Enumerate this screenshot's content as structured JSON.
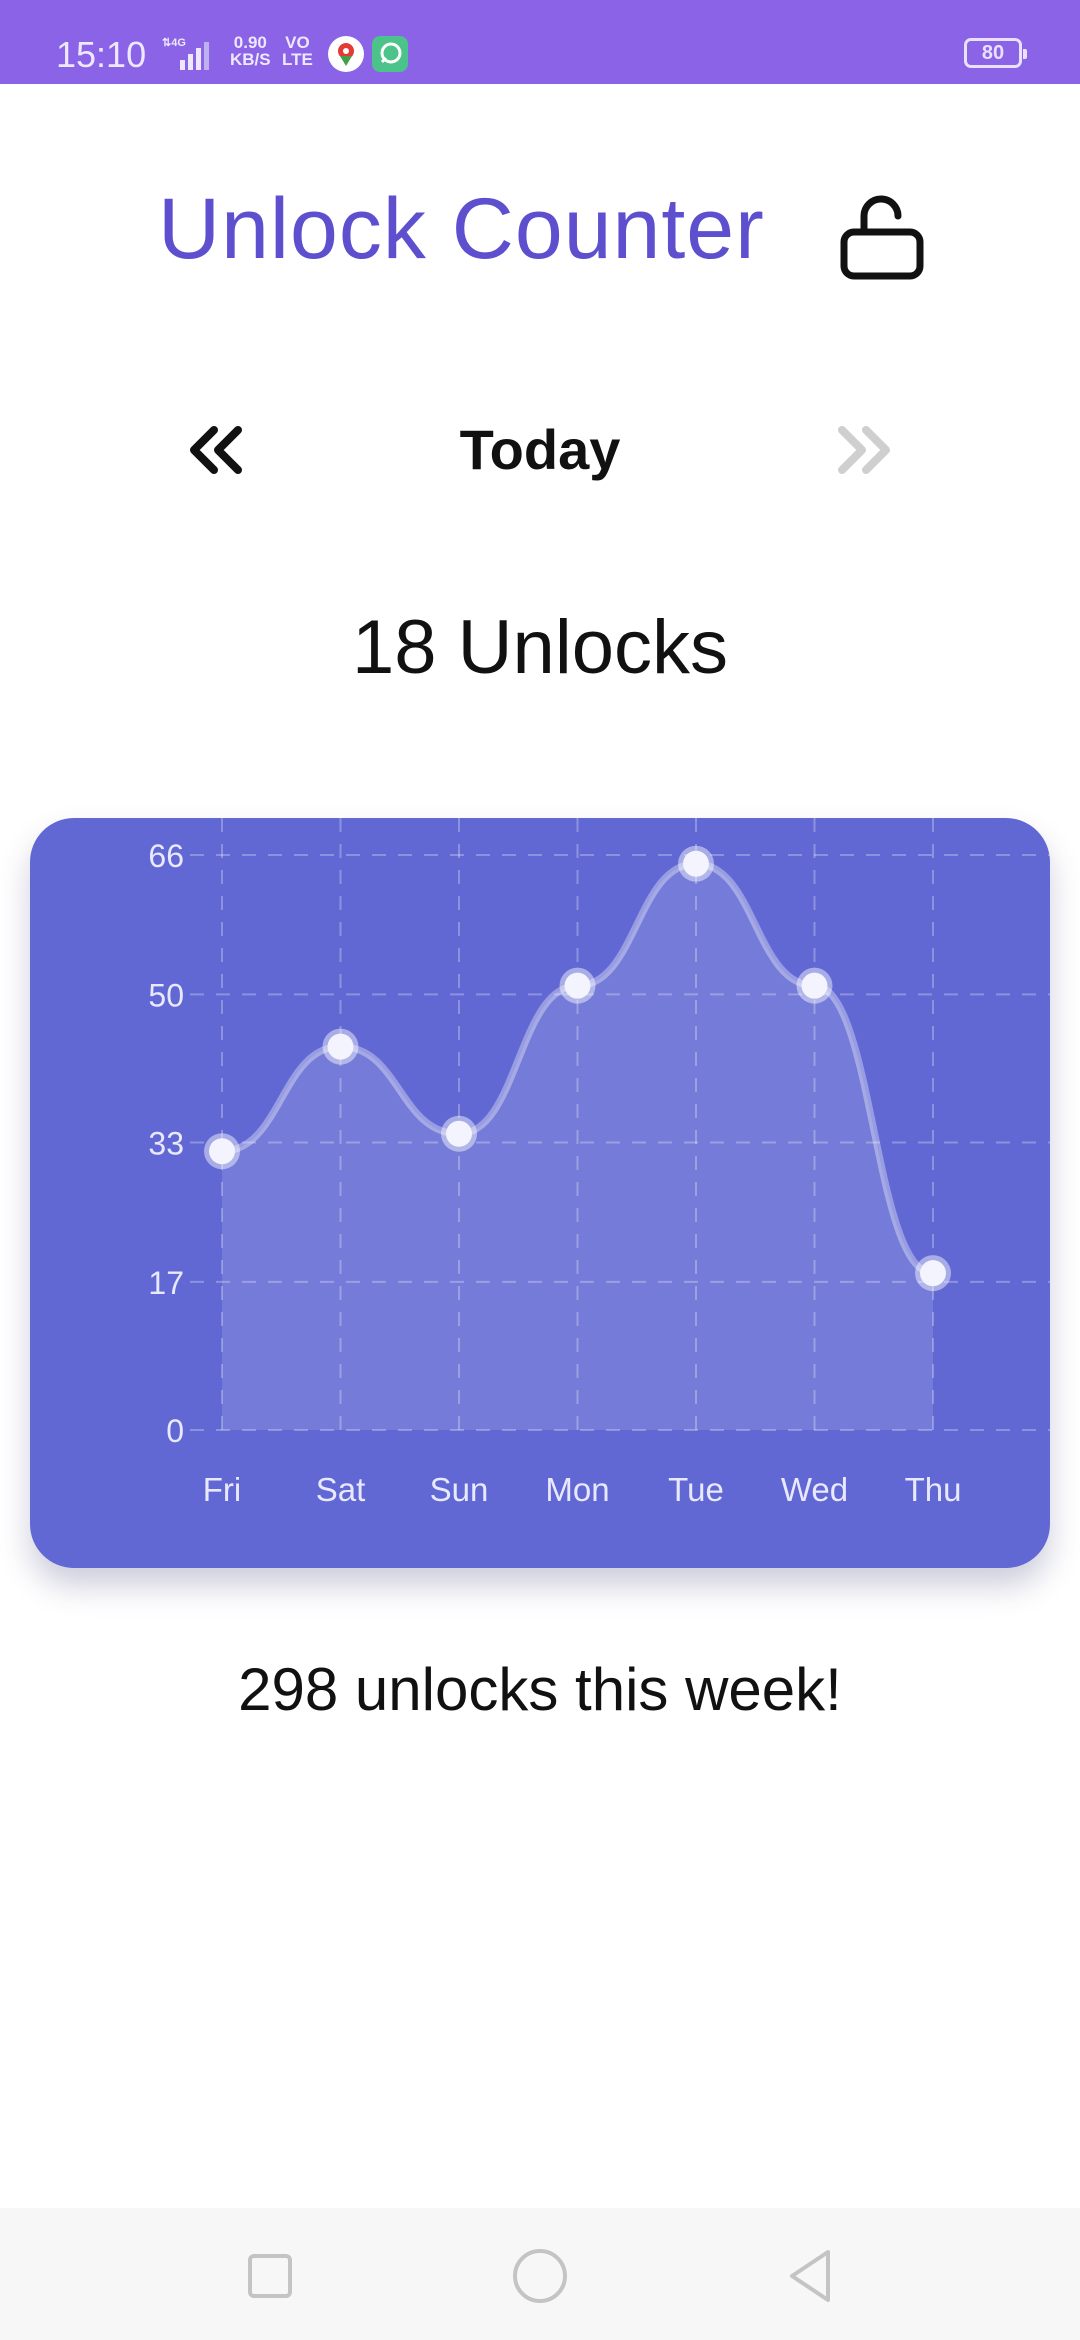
{
  "status_bar": {
    "time": "15:10",
    "network_speed_value": "0.90",
    "network_speed_unit": "KB/S",
    "volte_top": "VO",
    "volte_bottom": "LTE",
    "battery": "80",
    "signal_icon": "signal-4g-icon"
  },
  "header": {
    "title": "Unlock Counter",
    "icon": "unlock-icon",
    "accent_color": "#5e4fcf"
  },
  "day_nav": {
    "prev_icon": "chevrons-left-icon",
    "next_icon": "chevrons-right-icon",
    "label": "Today"
  },
  "summary": {
    "today_count": "18 Unlocks",
    "week_total": "298 unlocks this week!"
  },
  "chart_data": {
    "type": "area",
    "categories": [
      "Fri",
      "Sat",
      "Sun",
      "Mon",
      "Tue",
      "Wed",
      "Thu"
    ],
    "values": [
      32,
      44,
      34,
      51,
      65,
      51,
      18
    ],
    "y_ticks": [
      0,
      17,
      33,
      50,
      66
    ],
    "ylim": [
      0,
      66
    ],
    "grid": true,
    "background_color": "#6168d3"
  },
  "system_nav": {
    "recents_icon": "square-icon",
    "home_icon": "circle-icon",
    "back_icon": "triangle-back-icon"
  }
}
